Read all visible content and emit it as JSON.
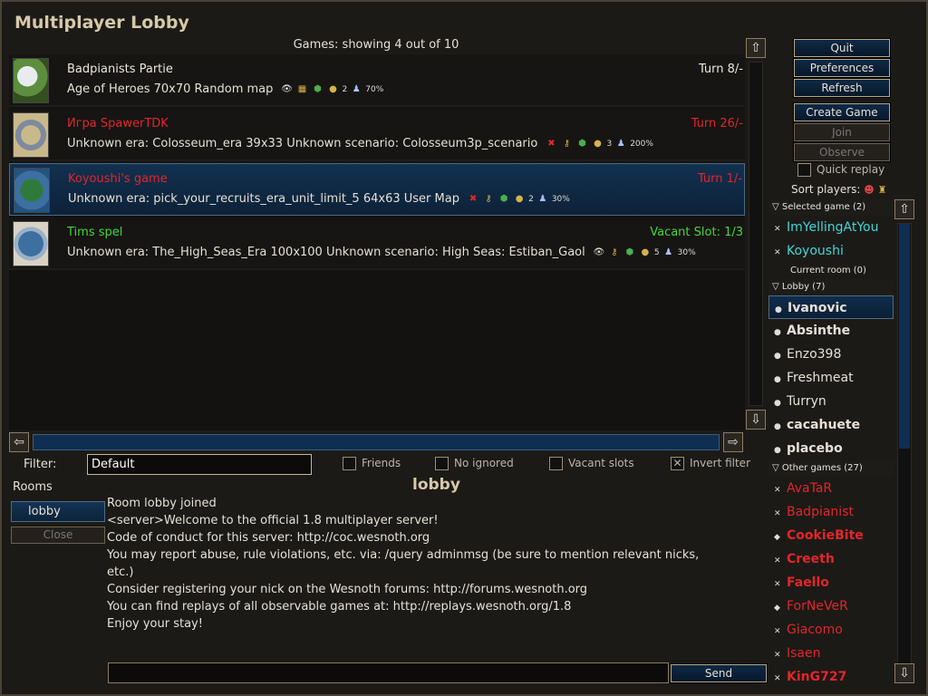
{
  "window": {
    "title": "Multiplayer Lobby"
  },
  "games": {
    "header": "Games: showing 4 out of 10",
    "rows": [
      {
        "name": "Badpianists Partie",
        "turn": "Turn 8/-",
        "desc": "Age of Heroes 70x70 Random map",
        "players": "2",
        "vision": "70%",
        "color": "#ece6da"
      },
      {
        "name": "Игра SpawerTDK",
        "turn": "Turn 26/-",
        "desc": "Unknown era: Colosseum_era 39x33 Unknown scenario: Colosseum3p_scenario",
        "players": "3",
        "vision": "200%",
        "color": "#e2262a"
      },
      {
        "name": "Koyoushi's game",
        "turn": "Turn 1/-",
        "desc": "Unknown era: pick_your_recruits_era_unit_limit_5 64x63 User Map",
        "players": "2",
        "vision": "30%",
        "color": "#e2262a"
      },
      {
        "name": "Tims spel",
        "turn": "Vacant Slot: 1/3",
        "desc": "Unknown era: The_High_Seas_Era 100x100 Unknown scenario: High Seas: Estiban_Gaol",
        "players": "5",
        "vision": "30%",
        "color": "#45d63c"
      }
    ]
  },
  "buttons": {
    "quit": "Quit",
    "preferences": "Preferences",
    "refresh": "Refresh",
    "create_game": "Create Game",
    "join": "Join",
    "observe": "Observe",
    "send": "Send",
    "close": "Close"
  },
  "quick_replay": "Quick replay",
  "sort_players": "Sort players:",
  "players": {
    "selected_game": "Selected game (2)",
    "selected": [
      "ImYellingAtYou",
      "Koyoushi"
    ],
    "current_room": "Current room (0)",
    "lobby": "Lobby (7)",
    "lobby_players": [
      "Ivanovic",
      "Absinthe",
      "Enzo398",
      "Freshmeat",
      "Turryn",
      "cacahuete",
      "placebo"
    ],
    "other_games": "Other games (27)",
    "other": [
      "AvaTaR",
      "Badpianist",
      "CookieBite",
      "Creeth",
      "Faello",
      "ForNeVeR",
      "Giacomo",
      "Isaen",
      "KinG727"
    ]
  },
  "filter": {
    "label": "Filter:",
    "value": "Default",
    "friends": "Friends",
    "no_ignored": "No ignored",
    "vacant_slots": "Vacant slots",
    "invert": "Invert filter"
  },
  "rooms": {
    "label": "Rooms",
    "tab": "lobby"
  },
  "chat": {
    "title": "lobby",
    "lines": [
      "Room lobby joined",
      "<server>Welcome to the official 1.8 multiplayer server!",
      "Code of conduct for this server: http://coc.wesnoth.org",
      "You may report abuse, rule violations, etc. via: /query adminmsg (be sure to mention relevant nicks,",
      "etc.)",
      "Consider registering your nick on the Wesnoth forums: http://forums.wesnoth.org",
      "You can find replays of all observable games at: http://replays.wesnoth.org/1.8",
      "Enjoy your stay!"
    ]
  }
}
